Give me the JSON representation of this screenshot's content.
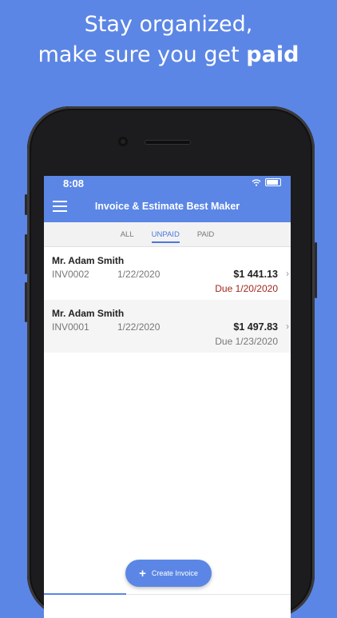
{
  "promo": {
    "line1": "Stay organized,",
    "line2_prefix": "make sure you get ",
    "line2_bold": "paid"
  },
  "status": {
    "time": "8:08"
  },
  "appbar": {
    "title": "Invoice & Estimate Best Maker"
  },
  "tabs": [
    {
      "label": "ALL",
      "active": false
    },
    {
      "label": "UNPAID",
      "active": true
    },
    {
      "label": "PAID",
      "active": false
    }
  ],
  "invoices": [
    {
      "client": "Mr. Adam Smith",
      "number": "INV0002",
      "date": "1/22/2020",
      "amount": "$1 441.13",
      "due": "Due 1/20/2020",
      "overdue": true
    },
    {
      "client": "Mr. Adam Smith",
      "number": "INV0001",
      "date": "1/22/2020",
      "amount": "$1 497.83",
      "due": "Due 1/23/2020",
      "overdue": false
    }
  ],
  "fab": {
    "label": "Create Invoice"
  },
  "colors": {
    "brand": "#5b86e5",
    "overdue": "#a3281e",
    "tab_active": "#4a78dc"
  }
}
